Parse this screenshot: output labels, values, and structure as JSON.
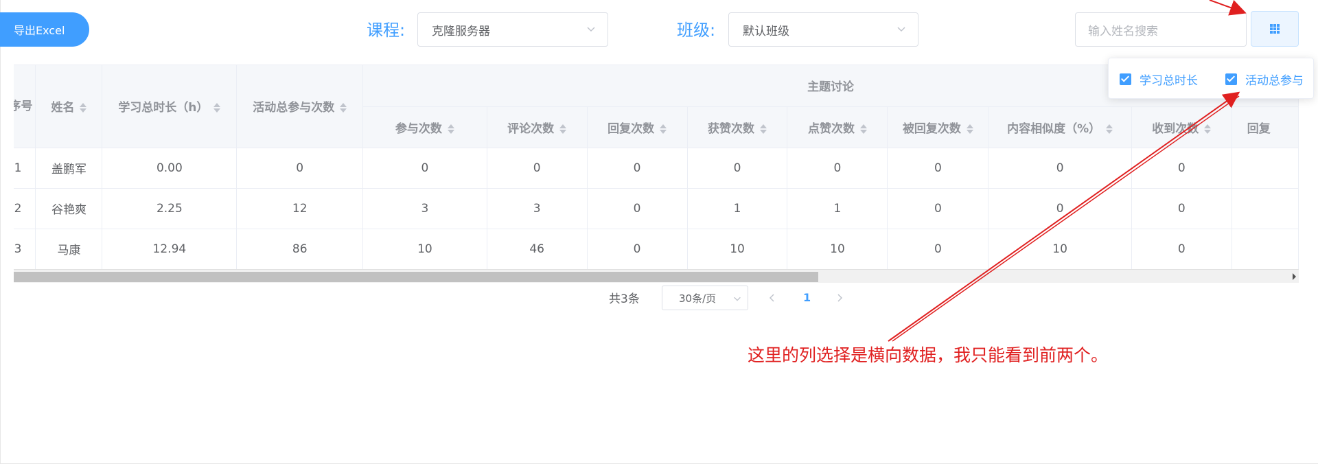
{
  "toolbar": {
    "export_label": "导出Excel",
    "course_label": "课程:",
    "course_value": "克隆服务器",
    "class_label": "班级:",
    "class_value": "默认班级",
    "search_placeholder": "输入姓名搜索",
    "column_button_icon": "grid-icon"
  },
  "table": {
    "headers": {
      "index": "序号",
      "name": "姓名",
      "study_time": "学习总时长（h）",
      "activity_total": "活动总参与次数",
      "group": "主题讨论",
      "sub": [
        "参与次数",
        "评论次数",
        "回复次数",
        "获赞次数",
        "点赞次数",
        "被回复次数",
        "内容相似度（%）",
        "收到次数",
        "回复"
      ]
    },
    "rows": [
      [
        "1",
        "盖鹏军",
        "0.00",
        "0",
        "0",
        "0",
        "0",
        "0",
        "0",
        "0",
        "0",
        "0",
        ""
      ],
      [
        "2",
        "谷艳爽",
        "2.25",
        "12",
        "3",
        "3",
        "0",
        "1",
        "1",
        "0",
        "0",
        "0",
        ""
      ],
      [
        "3",
        "马康",
        "12.94",
        "86",
        "10",
        "46",
        "0",
        "10",
        "10",
        "0",
        "10",
        "0",
        ""
      ]
    ]
  },
  "pagination": {
    "total": "共3条",
    "page_size": "30条/页",
    "current_page": "1"
  },
  "column_popover": {
    "items": [
      {
        "label": "学习总时长",
        "checked": true
      },
      {
        "label": "活动总参与",
        "checked": true
      }
    ]
  },
  "annotation": {
    "text": "这里的列选择是横向数据，我只能看到前两个。",
    "color": "#e02020"
  },
  "colors": {
    "primary": "#409eff",
    "annotation": "#e02020"
  }
}
